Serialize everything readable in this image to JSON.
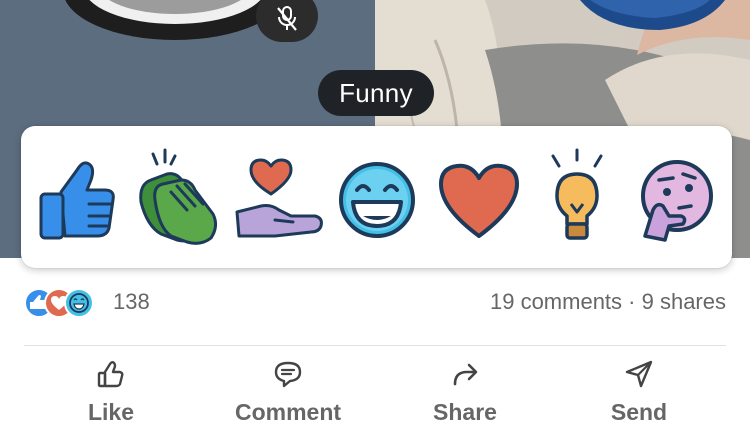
{
  "tooltip": {
    "text": "Funny"
  },
  "reactions": [
    {
      "name": "Like",
      "icon": "thumbs-up-icon"
    },
    {
      "name": "Celebrate",
      "icon": "clapping-hands-icon"
    },
    {
      "name": "Support",
      "icon": "heart-in-hand-icon"
    },
    {
      "name": "Funny",
      "icon": "laughing-face-icon"
    },
    {
      "name": "Love",
      "icon": "heart-icon"
    },
    {
      "name": "Insightful",
      "icon": "lightbulb-icon"
    },
    {
      "name": "Curious",
      "icon": "thinking-face-icon"
    }
  ],
  "stats": {
    "reaction_count": "138",
    "comments": "19 comments",
    "separator": " · ",
    "shares": "9 shares"
  },
  "actions": {
    "like": "Like",
    "comment": "Comment",
    "share": "Share",
    "send": "Send"
  },
  "colors": {
    "like_blue": "#378fe9",
    "celebrate_green": "#5aa849",
    "support_purple": "#b8a4d8",
    "funny_cyan": "#44bfe6",
    "love_red": "#e06a4f",
    "insightful_yellow": "#f5bb5c",
    "curious_pink": "#e3b8e0",
    "outline": "#1d3a5a"
  }
}
